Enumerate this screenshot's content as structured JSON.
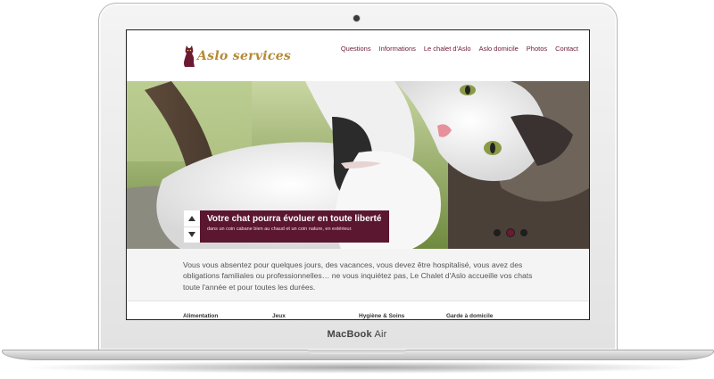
{
  "device": {
    "brand_bold": "MacBook",
    "brand_light": "Air"
  },
  "header": {
    "logo_text": "Aslo services",
    "nav": [
      "Questions",
      "Informations",
      "Le chalet d'Aslo",
      "Aslo domicile",
      "Photos",
      "Contact"
    ]
  },
  "slider": {
    "title": "Votre chat pourra évoluer en toute liberté",
    "subtitle": "dans un coin cabane bien au chaud et un coin nature, en extérieur.",
    "active_dot": 1
  },
  "intro": {
    "text": "Vous vous absentez pour quelques jours, des vacances, vous devez être hospitalisé, vous avez des obligations familiales ou professionnelles… ne vous inquiétez pas, Le Chalet d'Aslo accueille vos chats toute l'année et pour toutes les durées."
  },
  "columns": [
    "Alimentation",
    "Jeux",
    "Hygiène & Soins",
    "Garde à domicile"
  ],
  "colors": {
    "accent": "#5b1630",
    "nav_text": "#6b1a32",
    "logo_gold": "#b58a36"
  }
}
